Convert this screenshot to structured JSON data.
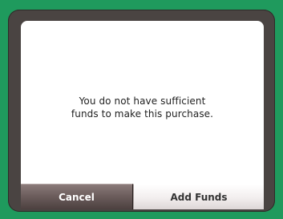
{
  "dialog": {
    "message_line1": "You do not have sufficient",
    "message_line2": "funds to make this purchase.",
    "cancel_label": "Cancel",
    "add_funds_label": "Add Funds"
  },
  "colors": {
    "frame": "#1f9a5d",
    "dialog_border": "#4a4442",
    "cancel_button": "#6d5e5d",
    "add_funds_button": "#f2eeee"
  }
}
